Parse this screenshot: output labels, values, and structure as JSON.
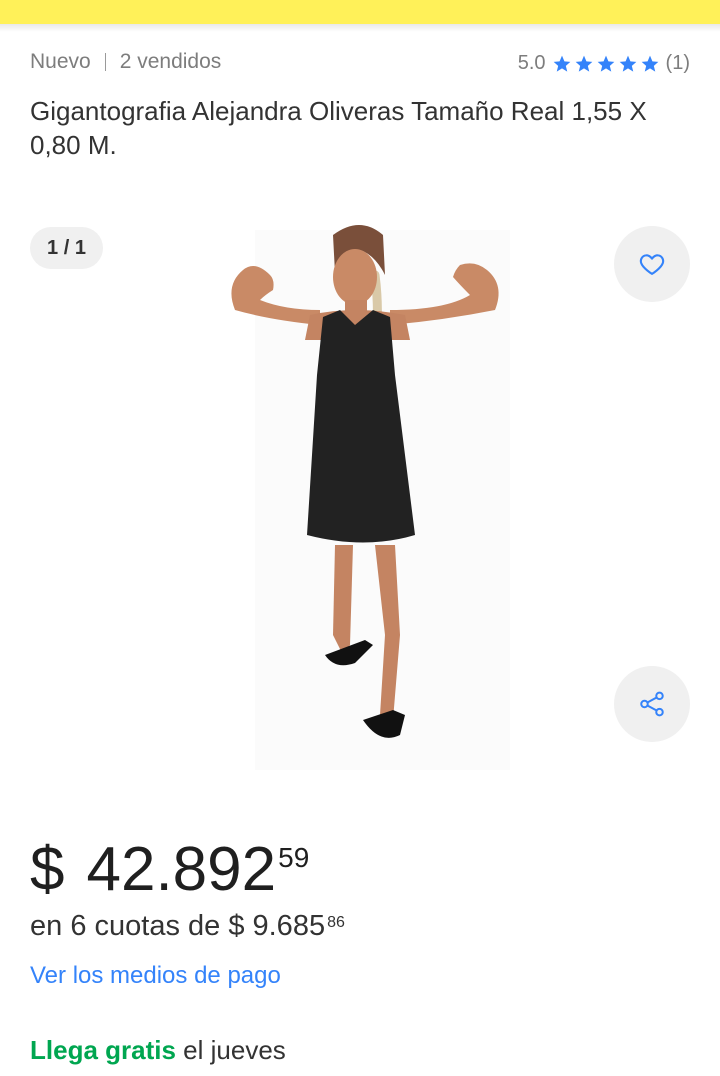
{
  "header": {
    "color": "#fff159"
  },
  "product": {
    "condition": "Nuevo",
    "sold": "2 vendidos",
    "rating": {
      "score": "5.0",
      "stars": 5,
      "count": "(1)",
      "star_color": "#3483fa"
    },
    "title": "Gigantografia Alejandra Oliveras Tamaño Real 1,55 X 0,80 M."
  },
  "gallery": {
    "counter": "1 / 1",
    "favorite_icon": "heart-icon",
    "share_icon": "share-icon",
    "image_description": "life-size cutout of a woman in a black dress flexing her arms"
  },
  "pricing": {
    "currency": "$",
    "integer": "42.892",
    "cents": "59",
    "installments_text": "en 6 cuotas de $ 9.685",
    "installments_cents": "86",
    "payment_link": "Ver los medios de pago"
  },
  "shipping": {
    "free_label": "Llega gratis",
    "day": " el jueves",
    "free_color": "#00a650"
  }
}
